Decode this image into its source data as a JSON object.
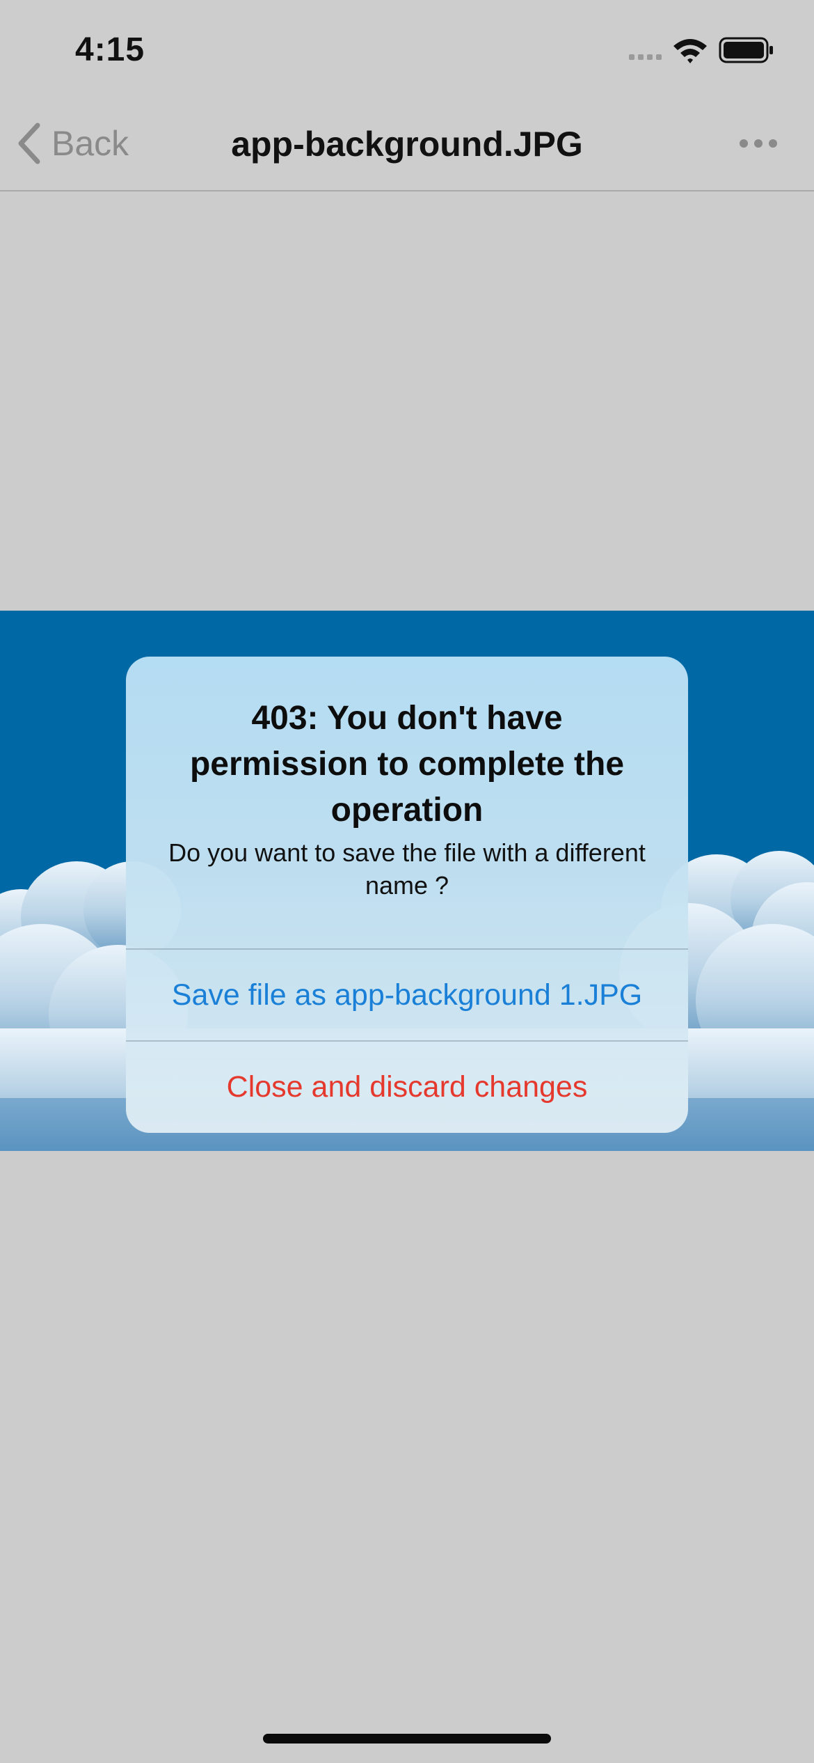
{
  "status_bar": {
    "time": "4:15",
    "icons": [
      "signal-icon",
      "wifi-icon",
      "battery-icon"
    ]
  },
  "nav_bar": {
    "back_label": "Back",
    "title": "app-background.JPG",
    "more_icon": "more-icon"
  },
  "alert": {
    "title": "403: You don't have permission to complete the operation",
    "message": "Do you want to save the file with a different name ?",
    "actions": [
      {
        "label": "Save file as app-background 1.JPG",
        "color": "#1a7fd6"
      },
      {
        "label": "Close and discard changes",
        "color": "#e5392e"
      }
    ]
  },
  "colors": {
    "background": "#cccccc",
    "image_sky": "#0069a5"
  }
}
